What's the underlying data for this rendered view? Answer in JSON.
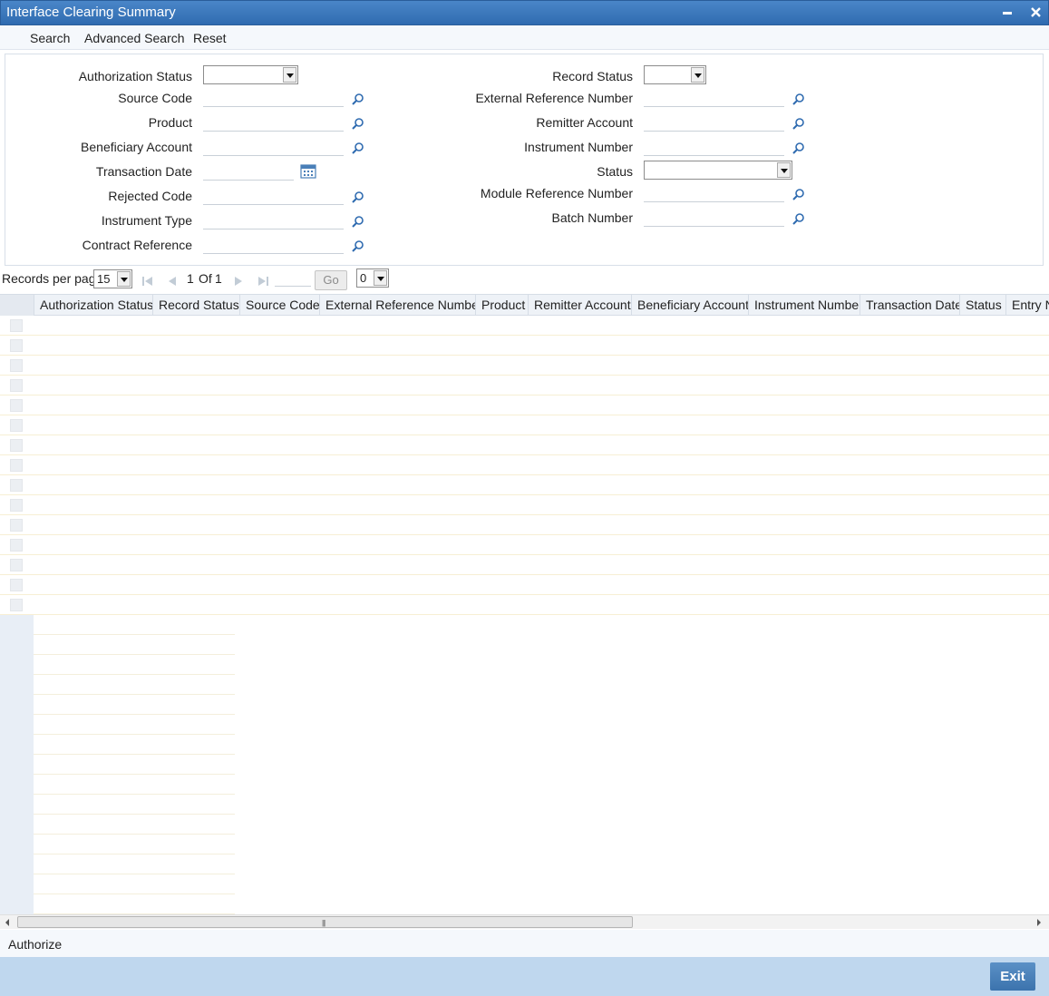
{
  "window": {
    "title": "Interface Clearing Summary"
  },
  "menu": {
    "search": "Search",
    "advanced_search": "Advanced Search",
    "reset": "Reset"
  },
  "form": {
    "left": {
      "authorization_status": "Authorization Status",
      "source_code": "Source Code",
      "product": "Product",
      "beneficiary_account": "Beneficiary Account",
      "transaction_date": "Transaction Date",
      "rejected_code": "Rejected Code",
      "instrument_type": "Instrument Type",
      "contract_reference": "Contract Reference"
    },
    "right": {
      "record_status": "Record Status",
      "external_reference_number": "External Reference Number",
      "remitter_account": "Remitter Account",
      "instrument_number": "Instrument Number",
      "status": "Status",
      "module_reference_number": "Module Reference Number",
      "batch_number": "Batch Number"
    }
  },
  "pager": {
    "records_per_page_label": "Records per page",
    "records_per_page_value": "15",
    "current_page": "1",
    "of_label": "Of",
    "total_pages": "1",
    "go_label": "Go",
    "extra_select_value": "0"
  },
  "grid": {
    "columns": [
      "Authorization Status",
      "Record Status",
      "Source Code",
      "External Reference Number",
      "Product",
      "Remitter Account",
      "Beneficiary Account",
      "Instrument Number",
      "Transaction Date",
      "Status",
      "Entry N"
    ],
    "rows": []
  },
  "bottom": {
    "authorize": "Authorize",
    "exit": "Exit"
  },
  "colors": {
    "titlebar": "#2f6bb0",
    "footer": "#bfd7ee",
    "exit_button": "#3c73ad",
    "row_border": "#f7efd4"
  }
}
